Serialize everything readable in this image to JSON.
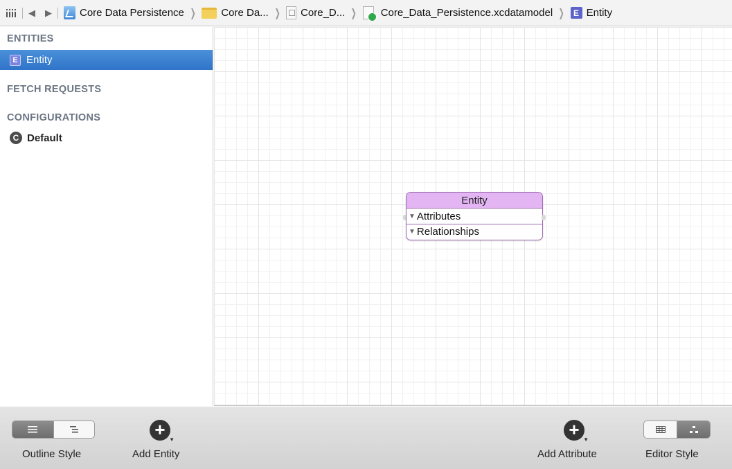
{
  "jumpbar": {
    "crumbs": [
      {
        "label": "Core Data Persistence",
        "icon": "project-icon"
      },
      {
        "label": "Core Da...",
        "icon": "folder-icon"
      },
      {
        "label": "Core_D...",
        "icon": "file-icon"
      },
      {
        "label": "Core_Data_Persistence.xcdatamodel",
        "icon": "data-model-icon"
      },
      {
        "label": "Entity",
        "icon": "entity-icon",
        "icon_letter": "E"
      }
    ]
  },
  "sidebar": {
    "entities_header": "ENTITIES",
    "entity_icon_letter": "E",
    "entity_item": "Entity",
    "fetch_requests_header": "FETCH REQUESTS",
    "configurations_header": "CONFIGURATIONS",
    "config_icon_letter": "C",
    "config_item": "Default"
  },
  "canvas": {
    "entity": {
      "title": "Entity",
      "sections": [
        "Attributes",
        "Relationships"
      ],
      "header_color": "#e3b6f3",
      "border_color": "#a06ab5"
    }
  },
  "toolbar": {
    "outline_style_label": "Outline Style",
    "add_entity_label": "Add Entity",
    "add_attribute_label": "Add Attribute",
    "editor_style_label": "Editor Style"
  },
  "colors": {
    "selection": "#3a7fd0",
    "section_header": "#6b7583"
  }
}
